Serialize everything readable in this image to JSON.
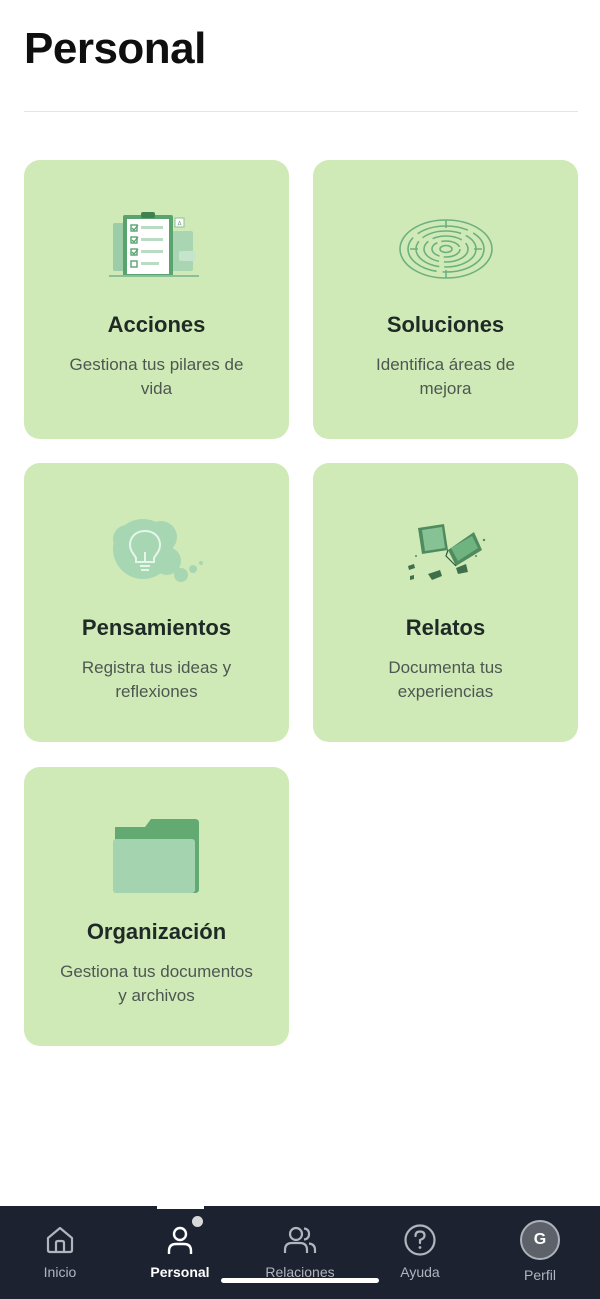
{
  "header": {
    "title": "Personal"
  },
  "cards": [
    {
      "title": "Acciones",
      "description": "Gestiona tus pilares de vida",
      "icon": "checklist-icon"
    },
    {
      "title": "Soluciones",
      "description": "Identifica áreas de mejora",
      "icon": "maze-icon"
    },
    {
      "title": "Pensamientos",
      "description": "Registra tus ideas y reflexiones",
      "icon": "lightbulb-icon"
    },
    {
      "title": "Relatos",
      "description": "Documenta tus experiencias",
      "icon": "book-icon"
    },
    {
      "title": "Organización",
      "description": "Gestiona tus documentos y archivos",
      "icon": "folder-icon"
    }
  ],
  "nav": {
    "items": [
      {
        "label": "Inicio",
        "icon": "home-icon"
      },
      {
        "label": "Personal",
        "icon": "person-icon",
        "active": true
      },
      {
        "label": "Relaciones",
        "icon": "people-icon"
      },
      {
        "label": "Ayuda",
        "icon": "help-icon"
      },
      {
        "label": "Perfil",
        "avatar_initial": "G"
      }
    ]
  },
  "colors": {
    "card_bg": "#d0eab7",
    "nav_bg": "#1c2230",
    "accent_green": "#5fa873"
  }
}
